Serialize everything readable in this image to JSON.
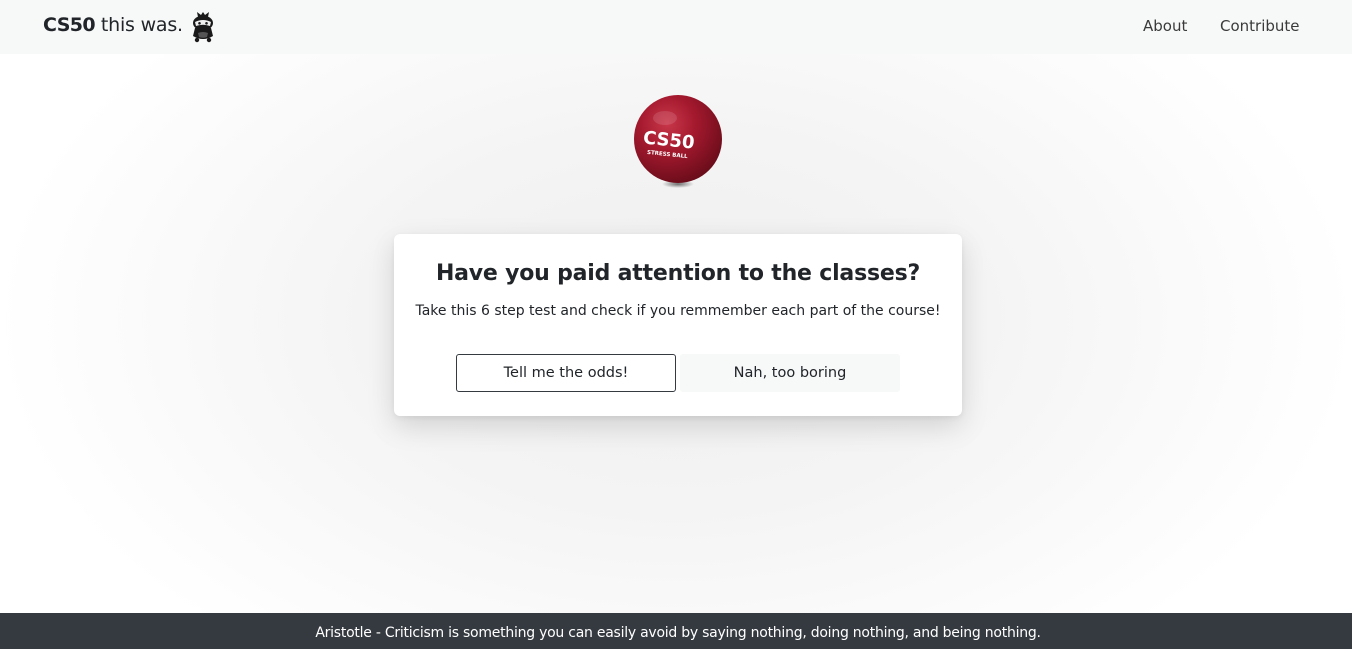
{
  "navbar": {
    "brand_bold": "CS50",
    "brand_rest": " this was.",
    "logo_icon": "ninja-mascot-icon",
    "links": {
      "about": "About",
      "contribute": "Contribute"
    }
  },
  "hero": {
    "image_icon": "cs50-stress-ball-image",
    "ball_brand": "CS50",
    "ball_caption": "STRESS BALL"
  },
  "card": {
    "title": "Have you paid attention to the classes?",
    "text": "Take this 6 step test and check if you remmember each part of the course!",
    "primary_button": "Tell me the odds!",
    "secondary_button": "Nah, too boring"
  },
  "footer": {
    "quote": "Aristotle - Criticism is something you can easily avoid by saying nothing, doing nothing, and being nothing."
  },
  "colors": {
    "navbar_bg": "#f7f8f8",
    "footer_bg": "#343a40",
    "ball_red": "#a5192e",
    "text": "#212529"
  }
}
